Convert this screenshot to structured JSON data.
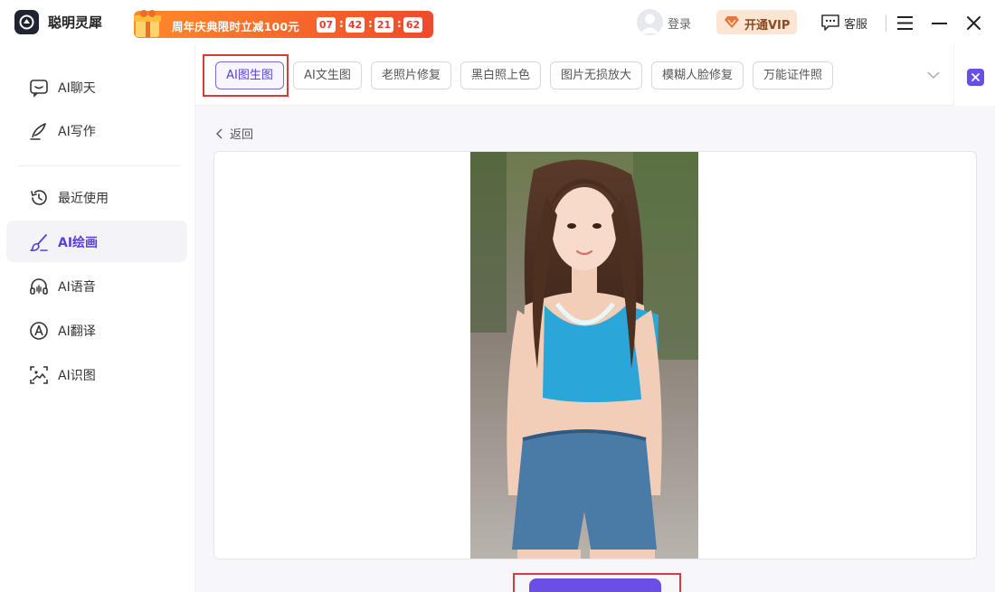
{
  "app": {
    "name": "聪明灵犀"
  },
  "promo": {
    "text": "周年庆典限时立减100元",
    "countdown": [
      "07",
      "42",
      "21",
      "62"
    ]
  },
  "header": {
    "login_label": "登录",
    "vip_label": "开通VIP",
    "service_label": "客服"
  },
  "sidebar": {
    "items": [
      {
        "label": "AI聊天",
        "icon": "chat-icon"
      },
      {
        "label": "AI写作",
        "icon": "pen-icon"
      },
      {
        "label": "最近使用",
        "icon": "history-icon"
      },
      {
        "label": "AI绘画",
        "icon": "brush-icon",
        "active": true
      },
      {
        "label": "AI语音",
        "icon": "headphones-icon"
      },
      {
        "label": "AI翻译",
        "icon": "translate-icon"
      },
      {
        "label": "AI识图",
        "icon": "scan-image-icon"
      }
    ]
  },
  "tabs": [
    "AI图生图",
    "AI文生图",
    "老照片修复",
    "黑白照上色",
    "图片无损放大",
    "模糊人脸修复",
    "万能证件照"
  ],
  "active_tab": "AI图生图",
  "back_label": "返回",
  "colors": {
    "accent": "#6b4ee6",
    "highlight": "#d43c3c",
    "promo": "#f04a2b"
  }
}
